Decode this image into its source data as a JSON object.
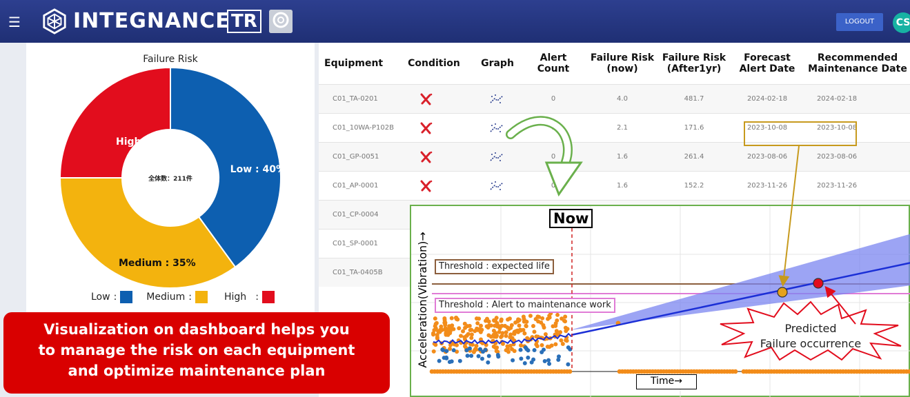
{
  "header": {
    "brand_name": "INTEGNANCE",
    "brand_tag": "TR",
    "logout_label": "LOGOUT",
    "user_initials": "CS"
  },
  "risk_panel": {
    "title": "Failure Risk",
    "center_label": "全体数：211件",
    "slices": [
      {
        "label": "Low : 40%",
        "value": 40,
        "color": "#0d5fb0"
      },
      {
        "label": "Medium : 35%",
        "value": 35,
        "color": "#f3b30e"
      },
      {
        "label": "High : 25%",
        "value": 25,
        "color": "#e20d1d"
      }
    ],
    "legend": [
      {
        "label": "Low",
        "color": "#0d5fb0"
      },
      {
        "label": "Medium",
        "color": "#f3b30e"
      },
      {
        "label": "High",
        "color": "#e20d1d"
      }
    ],
    "legend_sep": ":"
  },
  "table": {
    "headers": {
      "equipment": "Equipment",
      "condition": "Condition",
      "graph": "Graph",
      "alert_count": "Alert Count",
      "risk_now": "Failure Risk (now)",
      "risk_1yr": "Failure Risk (After1yr)",
      "forecast": "Forecast Alert Date",
      "recommended": "Recommended Maintenance Date"
    },
    "rows": [
      {
        "equipment": "C01_TA-0201",
        "alert_count": "0",
        "risk_now": "4.0",
        "risk_1yr": "481.7",
        "forecast": "2024-02-18",
        "recommended": "2024-02-18"
      },
      {
        "equipment": "C01_10WA-P102B",
        "alert_count": "0",
        "risk_now": "2.1",
        "risk_1yr": "171.6",
        "forecast": "2023-10-08",
        "recommended": "2023-10-08"
      },
      {
        "equipment": "C01_GP-0051",
        "alert_count": "0",
        "risk_now": "1.6",
        "risk_1yr": "261.4",
        "forecast": "2023-08-06",
        "recommended": "2023-08-06"
      },
      {
        "equipment": "C01_AP-0001",
        "alert_count": "0",
        "risk_now": "1.6",
        "risk_1yr": "152.2",
        "forecast": "2023-11-26",
        "recommended": "2023-11-26"
      },
      {
        "equipment": "C01_CP-0004",
        "alert_count": "",
        "risk_now": "",
        "risk_1yr": "",
        "forecast": "",
        "recommended": ""
      },
      {
        "equipment": "C01_SP-0001",
        "alert_count": "",
        "risk_now": "",
        "risk_1yr": "",
        "forecast": "",
        "recommended": ""
      },
      {
        "equipment": "C01_TA-0405B",
        "alert_count": "",
        "risk_now": "",
        "risk_1yr": "",
        "forecast": "",
        "recommended": ""
      }
    ]
  },
  "trend_chart": {
    "now_label": "Now",
    "y_label": "Acceleration(Vibration)→",
    "x_label": "Time→",
    "threshold_life": "Threshold : expected life",
    "threshold_alert": "Threshold : Alert to maintenance work",
    "predict_line1": "Predicted",
    "predict_line2": "Failure occurrence",
    "colors": {
      "measured": "#f28c1a",
      "measured_alt": "#2a6fb8",
      "trend": "#1b2fd6",
      "band": "#7b86f0",
      "life_line": "#8b5e3c",
      "alert_line": "#e07bd6",
      "now_line": "#d02020"
    }
  },
  "callout": {
    "line1": "Visualization on dashboard helps you",
    "line2": "to manage the risk on each equipment",
    "line3": "and optimize maintenance plan"
  }
}
